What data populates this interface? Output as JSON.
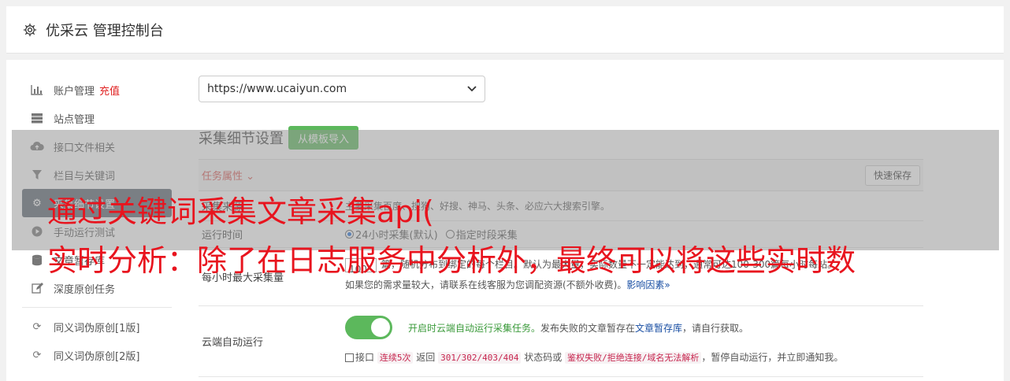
{
  "header": {
    "title": "优采云 管理控制台",
    "icon": "gear-icon"
  },
  "sidebar": {
    "items": [
      {
        "label": "账户管理",
        "badge": "充值",
        "icon": "bar-chart-icon"
      },
      {
        "label": "站点管理",
        "icon": "server-icon"
      },
      {
        "label": "接口文件相关",
        "icon": "cloud-upload-icon"
      },
      {
        "label": "栏目与关键词",
        "icon": "filter-icon"
      },
      {
        "label": "采集细节设置",
        "icon": "cogs-icon",
        "active": true
      },
      {
        "label": "手动运行测试",
        "icon": "play-circle-icon"
      },
      {
        "label": "文章暂存库",
        "icon": "database-icon"
      },
      {
        "label": "深度原创任务",
        "icon": "edit-icon"
      },
      {
        "label": "同义词伪原创[1版]",
        "icon": "refresh-icon"
      },
      {
        "label": "同义词伪原创[2版]",
        "icon": "refresh-icon"
      }
    ]
  },
  "main": {
    "site_select": "https://www.ucaiyun.com",
    "section_title": "采集细节设置",
    "import_button": "从模板导入",
    "tab_label": "任务属性 ",
    "quick_save": "快速保存",
    "rows": {
      "source_label": "采集来源",
      "source_value": "主要采集百度、搜狗、好搜、神马、头条、必应六大搜索引擎。",
      "runtime_label": "运行时间",
      "runtime_opt1": "24小时采集(默认)",
      "runtime_opt2": "指定时段采集",
      "max_label": "每小时最大采集量",
      "max_value": "100",
      "max_desc": "篇，随机分布到绑定的每个栏目。默认为最大量，实际数量不一定能达到，通常可达100-300篇每小时每站。",
      "max_note": "如果您的需求量较大，请联系在线客服为您调配资源(不额外收费)。",
      "max_link": "影响因素",
      "cloud_label": "云端自动运行",
      "cloud_on": "开启时云端自动运行采集任务。",
      "cloud_desc1": "发布失败的文章暂存在",
      "cloud_link": "文章暂存库",
      "cloud_desc2": "，请自行获取。",
      "api_prefix": "接口",
      "api_code1": "连续5次",
      "api_mid1": " 返回 ",
      "api_code2": "301/302/403/404",
      "api_mid2": " 状态码或 ",
      "api_code3": "鉴权失败/拒绝连接/域名无法解析",
      "api_suffix": "，暂停自动运行，并立即通知我。"
    }
  },
  "watermark": {
    "line1": "通过关键词采集文章采集api(",
    "line2": "实时分析：除了在日志服务中分析外，最终可以将这些实时数"
  }
}
